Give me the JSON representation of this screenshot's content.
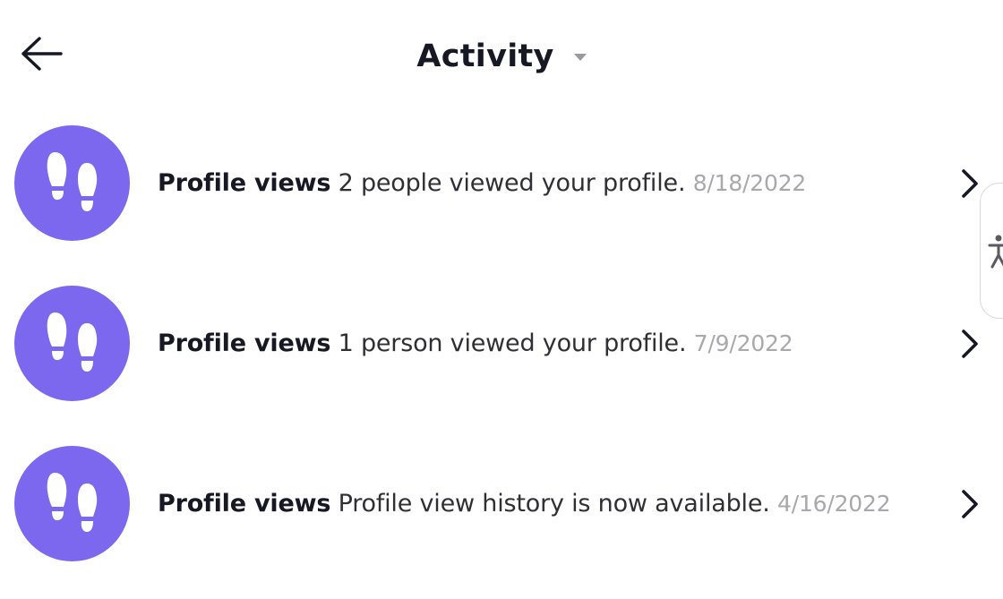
{
  "header": {
    "title": "Activity",
    "back_icon": "arrow-left-icon",
    "dropdown_icon": "caret-down-icon"
  },
  "activity": {
    "items": [
      {
        "title": "Profile views",
        "description": "2 people viewed your profile.",
        "date": "8/18/2022",
        "icon": "footprints-icon"
      },
      {
        "title": "Profile views",
        "description": "1 person viewed your profile.",
        "date": "7/9/2022",
        "icon": "footprints-icon"
      },
      {
        "title": "Profile views",
        "description": "Profile view history is now available.",
        "date": "4/16/2022",
        "icon": "footprints-icon"
      }
    ]
  },
  "accessibility": {
    "icon": "accessibility-icon"
  },
  "colors": {
    "avatar_bg": "#7b68ee",
    "text_primary": "#161823",
    "text_muted": "#a8a8ad"
  }
}
